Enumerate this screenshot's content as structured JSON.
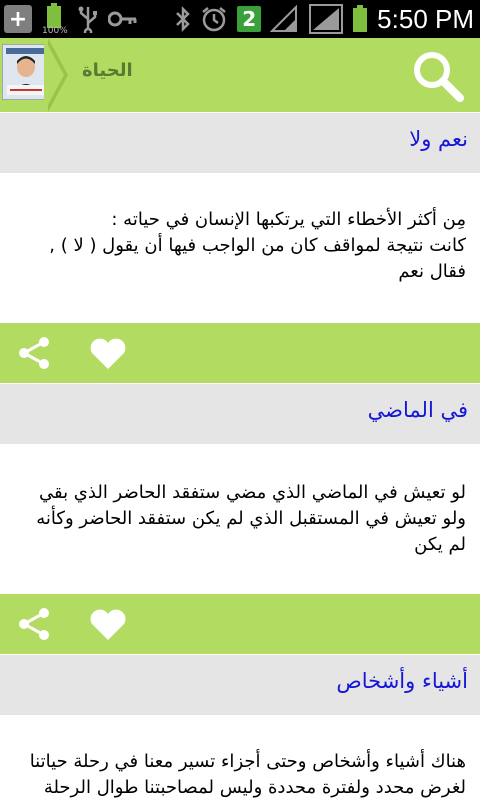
{
  "status_bar": {
    "battery_percent": "100%",
    "notification_badge": "2",
    "time": "5:50 PM"
  },
  "header": {
    "title": "الحياة"
  },
  "cards": [
    {
      "title": "نعم ولا",
      "body": "مِن أكثر الأخطاء التي يرتكبها الإنسان في حياته :\nكانت نتيجة لمواقف كان من الواجب فيها أن يقول ( لا ) , فقال نعم"
    },
    {
      "title": "في الماضي",
      "body": "لو تعيش في الماضي الذي مضي ستفقد الحاضر الذي بقي\nولو تعيش في المستقبل الذي لم يكن ستفقد الحاضر وكأنه لم يكن"
    },
    {
      "title": "أشياء وأشخاص",
      "body": "هناك أشياء وأشخاص وحتى أجزاء تسير معنا في رحلة حياتنا لغرض محدد ولفترة محددة وليس لمصاحبتنا طوال الرحلة ،ذلك"
    }
  ]
}
